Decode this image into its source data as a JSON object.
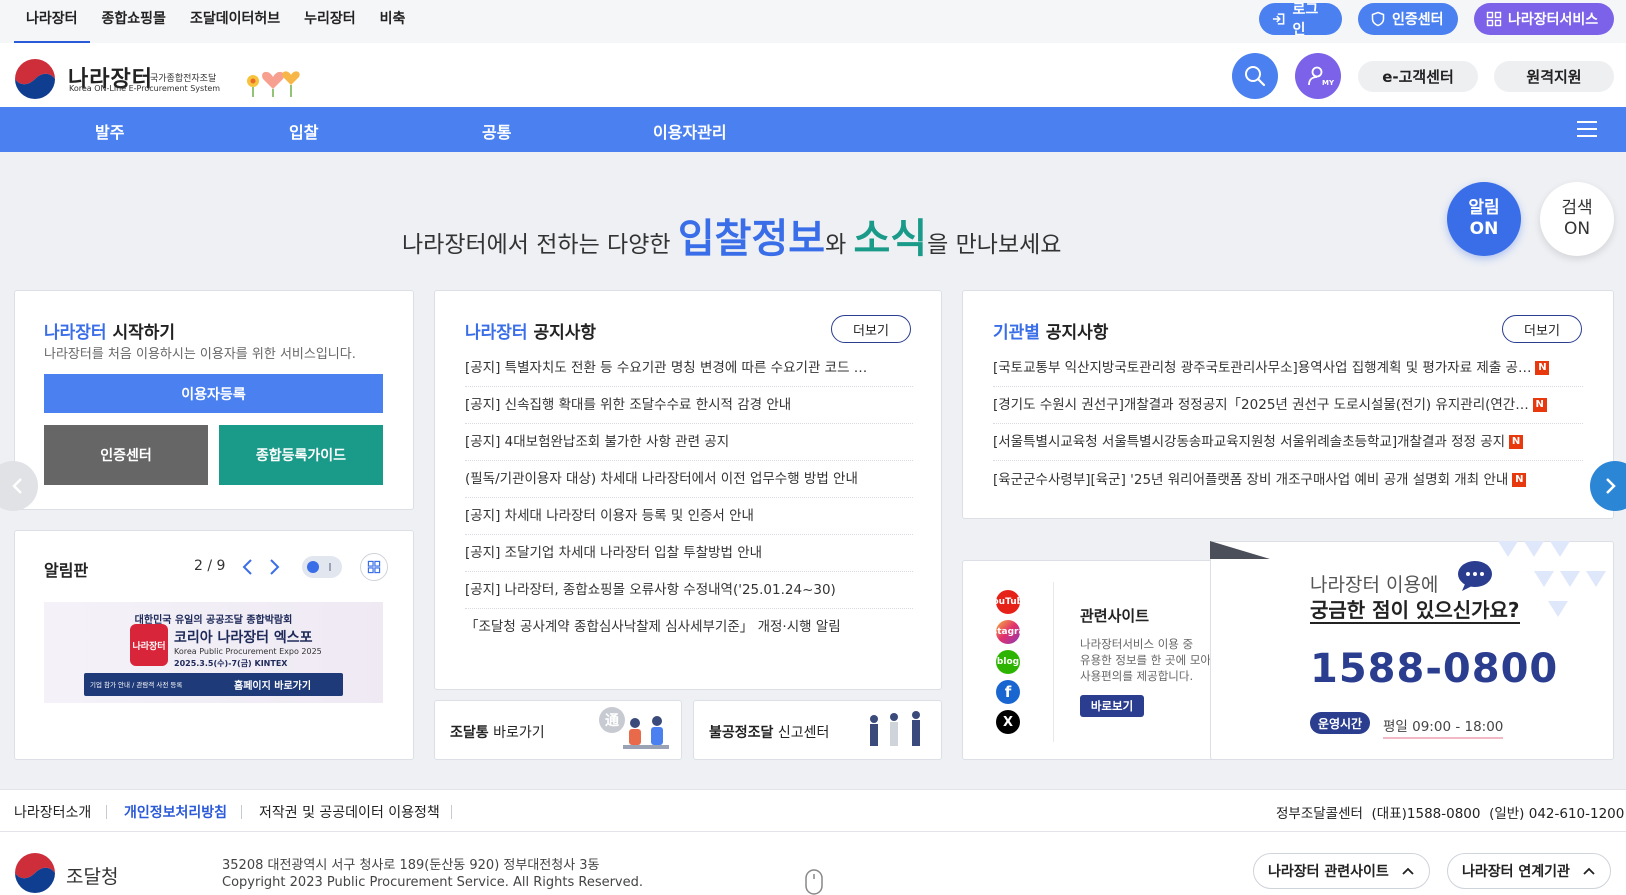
{
  "top_nav": [
    "나라장터",
    "종합쇼핑몰",
    "조달데이터허브",
    "누리장터",
    "비축"
  ],
  "top_buttons": {
    "login": "로그인",
    "cert": "인증센터",
    "service": "나라장터서비스"
  },
  "logo": {
    "title": "나라장터",
    "subtitle": "국가종합전자조달",
    "eng": "Korea ON-Line E-Procurement System"
  },
  "header_buttons": {
    "my": "MY",
    "customer": "e-고객센터",
    "remote": "원격지원"
  },
  "main_menu": [
    "발주",
    "입찰",
    "공통",
    "이용자관리"
  ],
  "hero": {
    "prefix": "나라장터에서 전하는 다양한",
    "word1": "입찰정보",
    "mid": "와",
    "word2": "소식",
    "suffix": "을 만나보세요"
  },
  "alert_on": {
    "line1": "알림",
    "line2": "ON"
  },
  "search_on": {
    "line1": "검색",
    "line2": "ON"
  },
  "start_card": {
    "title_hl": "나라장터",
    "title_rest": "시작하기",
    "desc": "나라장터를 처음 이용하시는 이용자를 위한 서비스입니다.",
    "register": "이용자등록",
    "cert": "인증센터",
    "guide": "종합등록가이드"
  },
  "board_card": {
    "title": "알림판",
    "page": "2 / 9",
    "banner_top": "대한민국 유일의 공공조달 종합박람회",
    "banner_title": "코리아 나라장터 엑스포",
    "banner_eng": "Korea Public Procurement Expo 2025",
    "banner_date": "2025.3.5(수)-7(금) KINTEX",
    "banner_left": "기업 참가 안내 / 관람객 사전 등록",
    "banner_cta": "홈페이지 바로가기",
    "banner_logo": "나라장터"
  },
  "notice_card": {
    "title_hl": "나라장터",
    "title_rest": "공지사항",
    "more": "더보기",
    "items": [
      "[공지] 특별자치도 전환 등 수요기관 명칭 변경에 따른 수요기관 코드 …",
      "[공지] 신속집행 확대를 위한 조달수수료 한시적 감경 안내",
      "[공지] 4대보험완납조회 불가한 사항 관련 공지",
      "(필독/기관이용자 대상) 차세대 나라장터에서 이전 업무수행 방법 안내",
      "[공지] 차세대 나라장터 이용자 등록 및 인증서 안내",
      "[공지] 조달기업 차세대 나라장터 입찰 투찰방법 안내",
      "[공지] 나라장터, 종합쇼핑몰 오류사항 수정내역('25.01.24~30)",
      "「조달청 공사계약 종합심사낙찰제 심사세부기준」 개정·시행 알림"
    ]
  },
  "agency_card": {
    "title_hl": "기관별",
    "title_rest": "공지사항",
    "more": "더보기",
    "badge": "N",
    "items": [
      "[국토교통부 익산지방국토관리청 광주국토관리사무소]용역사업 집행계획 및 평가자료 제출 공…",
      "[경기도 수원시 권선구]개찰결과 정정공지「2025년 권선구 도로시설물(전기) 유지관리(연간…",
      "[서울특별시교육청 서울특별시강동송파교육지원청 서울위례솔초등학교]개찰결과 정정 공지",
      "[육군군수사령부][육군] '25년 워리어플랫폼 장비 개조구매사업 예비 공개 설명회 개최 안내"
    ]
  },
  "shortcuts": {
    "jodal": {
      "bold": "조달통",
      "rest": "바로가기",
      "mark": "通"
    },
    "report": {
      "bold": "불공정조달",
      "rest": "신고센터"
    }
  },
  "related_sites": {
    "title": "관련사이트",
    "desc": [
      "나라장터서비스 이용 중",
      "유용한 정보를 한 곳에 모아",
      "사용편의를 제공합니다."
    ],
    "button": "바로보기",
    "social": [
      "YouTube",
      "Instagram",
      "blog",
      "f",
      "X"
    ]
  },
  "contact": {
    "line1": "나라장터 이용에",
    "line2": "궁금한 점이 있으신가요?",
    "phone": "1588-0800",
    "hours_label": "운영시간",
    "hours": "평일 09:00 - 18:00"
  },
  "footer": {
    "links": [
      "나라장터소개",
      "개인정보처리방침",
      "저작권 및 공공데이터 이용정책"
    ],
    "contact": "정부조달콜센터  (대표)1588-0800  (일반) 042-610-1200",
    "org": "조달청",
    "address": "35208 대전광역시 서구 청사로 189(둔산동 920) 정부대전청사 3동",
    "copyright": "Copyright 2023 Public Procurement Service. All Rights Reserved.",
    "related": "나라장터 관련사이트",
    "linked": "나라장터 연계기관"
  },
  "colors": {
    "brand_blue": "#4a80f0",
    "purple": "#7c62e8",
    "teal": "#1a9a88",
    "grey": "#666666",
    "navy": "#2a3d8f"
  }
}
